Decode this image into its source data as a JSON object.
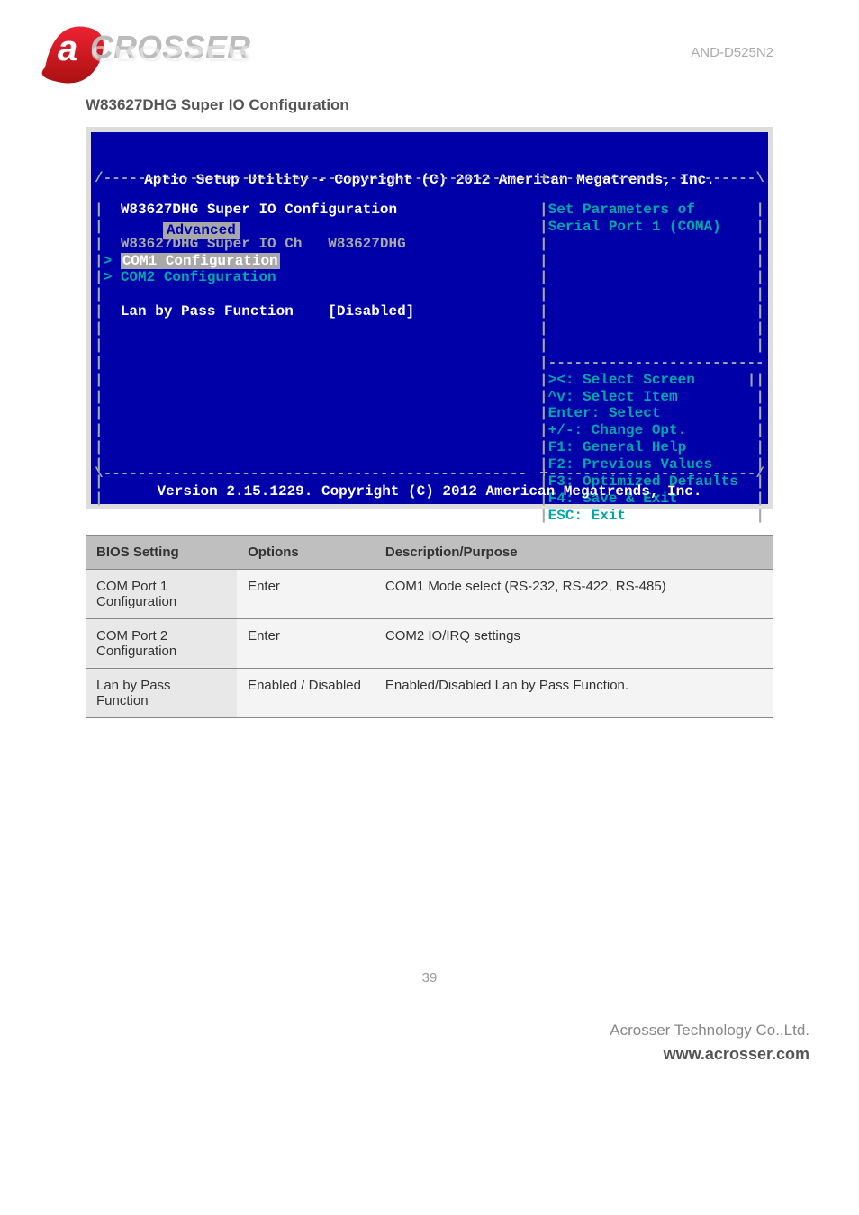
{
  "logo_text": "CROSSER",
  "model": "AND-D525N2",
  "section_title": "W83627DHG Super IO Configuration",
  "bios": {
    "title": "Aptio Setup Utility - Copyright (C) 2012 American Megatrends, Inc.",
    "tab": "Advanced",
    "heading": "W83627DHG Super IO Configuration",
    "chip_label": "W83627DHG Super IO Ch",
    "chip_value": "W83627DHG",
    "menu": {
      "com1": "COM1 Configuration",
      "com2": "COM2 Configuration"
    },
    "setting_label": "Lan by Pass Function",
    "setting_value": "[Disabled]",
    "help_line1": "Set Parameters of",
    "help_line2": "Serial Port 1 (COMA)",
    "keys": {
      "k1": "><: Select Screen",
      "k2": "^v: Select Item",
      "k3": "Enter: Select",
      "k4": "+/-: Change Opt.",
      "k5": "F1: General Help",
      "k6": "F2: Previous Values",
      "k7": "F3: Optimized Defaults",
      "k8": "F4: Save & Exit",
      "k9": "ESC: Exit"
    },
    "footer": "Version 2.15.1229. Copyright (C) 2012 American Megatrends, Inc."
  },
  "table": {
    "headers": {
      "h1": "BIOS Setting",
      "h2": "Options",
      "h3": "Description/Purpose"
    },
    "rows": [
      {
        "setting": "COM Port 1 Configuration",
        "options": "Enter",
        "desc": "COM1 Mode select (RS-232, RS-422, RS-485)"
      },
      {
        "setting": "COM Port 2 Configuration",
        "options": "Enter",
        "desc": "COM2 IO/IRQ settings"
      },
      {
        "setting": "Lan by Pass Function",
        "options": "Enabled / Disabled",
        "desc": "Enabled/Disabled Lan by Pass Function."
      }
    ]
  },
  "page_number": "39",
  "footer_company": "Acrosser Technology Co.,Ltd.",
  "footer_url": "www.acrosser.com"
}
